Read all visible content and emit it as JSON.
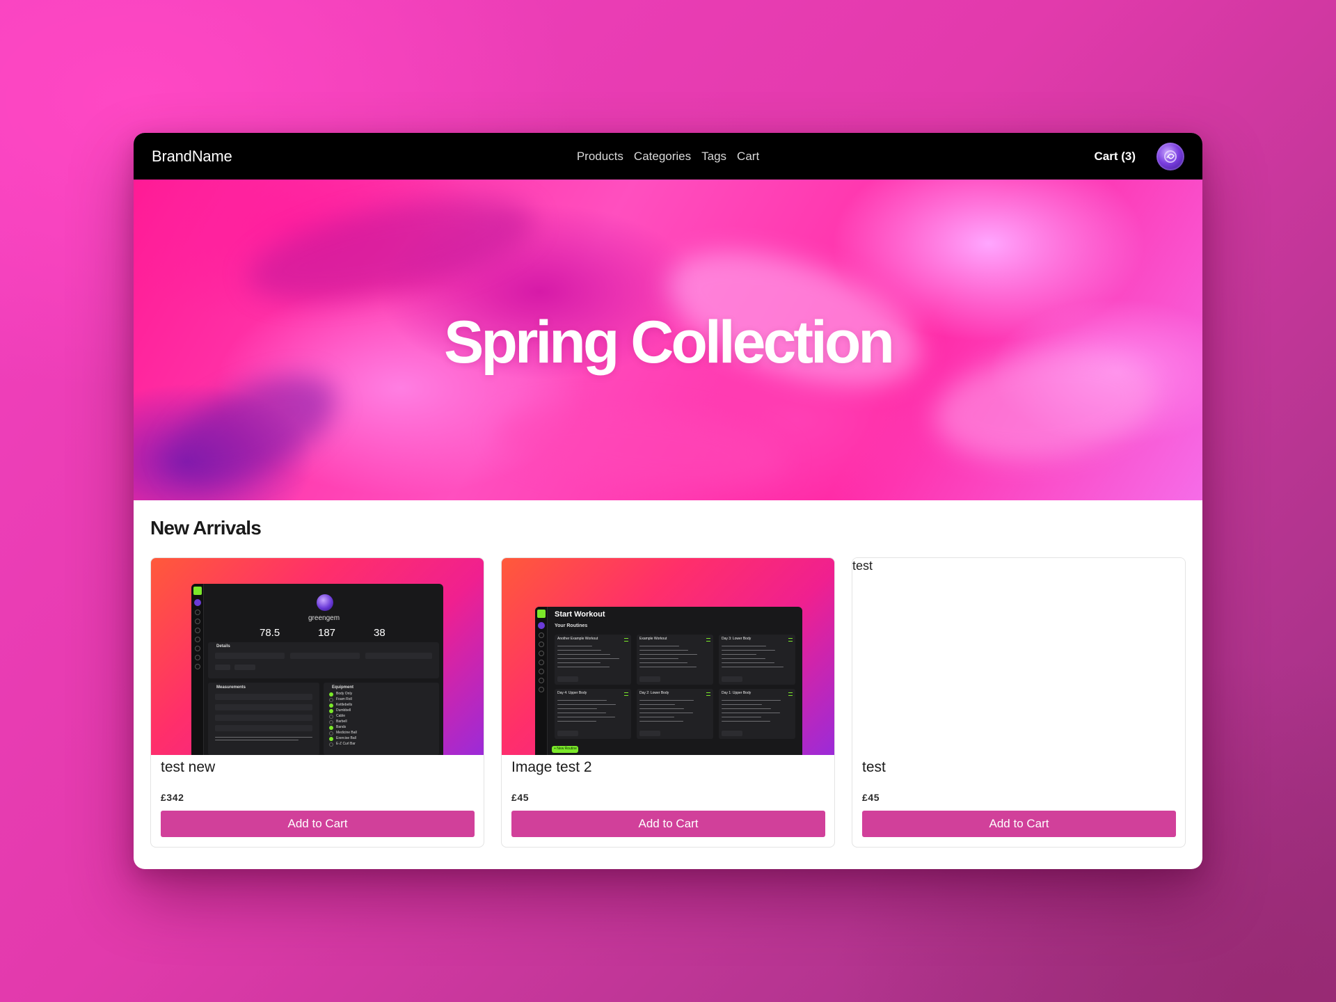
{
  "nav": {
    "brand": "BrandName",
    "links": [
      "Products",
      "Categories",
      "Tags",
      "Cart"
    ],
    "cart_label": "Cart (3)"
  },
  "hero": {
    "title": "Spring Collection"
  },
  "section": {
    "title": "New Arrivals"
  },
  "products": [
    {
      "name": "test new",
      "price": "£342",
      "button": "Add to Cart",
      "image_text": {
        "username": "greengem",
        "stat1": "78.5",
        "stat2": "187",
        "stat3": "38",
        "details": "Details",
        "measurements": "Measurements",
        "equipment": "Equipment",
        "equipment_items": [
          "Body Only",
          "Foam Roll",
          "Kettlebells",
          "Dumbbell",
          "Cable",
          "Barbell",
          "Bands",
          "Medicine Ball",
          "Exercise Ball",
          "E-Z Curl Bar"
        ]
      }
    },
    {
      "name": "Image test 2",
      "price": "£45",
      "button": "Add to Cart",
      "image_text": {
        "heading": "Start Workout",
        "subheading": "Your Routines",
        "routines": [
          "Another Example Workout",
          "Example Workout",
          "Day 3: Lower Body",
          "Day 4: Upper Body",
          "Day 2: Lower Body",
          "Day 1: Upper Body"
        ],
        "new_button": "+ New Routine"
      }
    },
    {
      "name": "test",
      "price": "£45",
      "button": "Add to Cart",
      "image_alt": "test"
    }
  ],
  "colors": {
    "accent": "#d1409a",
    "nav_bg": "#000000",
    "app_green": "#7be82a"
  }
}
